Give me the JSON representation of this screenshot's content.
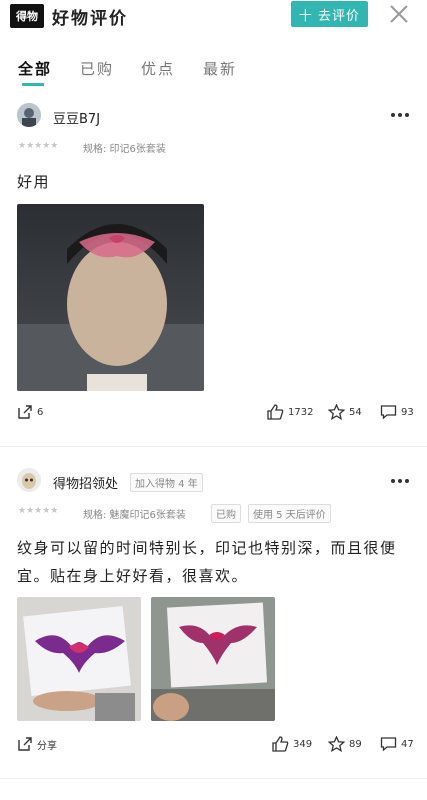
{
  "header": {
    "logo_text": "得物",
    "title": "好物评价",
    "review_button": "十 去评价"
  },
  "tabs": [
    {
      "label": "全部",
      "active": true
    },
    {
      "label": "已购",
      "active": false
    },
    {
      "label": "优点",
      "active": false
    },
    {
      "label": "最新",
      "active": false
    }
  ],
  "reviews": [
    {
      "username": "豆豆B7J",
      "spec": "规格: 印记6张套装",
      "text": "好用",
      "share_count": "6",
      "likes": "1732",
      "stars": "54",
      "comments": "93"
    },
    {
      "username": "得物招领处",
      "join_badge": "加入得物 4 年",
      "spec": "规格: 魅魔印记6张套装",
      "purchased_badge": "已购",
      "usage_badge": "使用 5 天后评价",
      "text": "纹身可以留的时间特别长，印记也特别深，而且很便宜。贴在身上好好看，很喜欢。",
      "share_label": "分享",
      "likes": "349",
      "stars": "89",
      "comments": "47"
    }
  ],
  "colors": {
    "accent": "#31b6b1"
  }
}
